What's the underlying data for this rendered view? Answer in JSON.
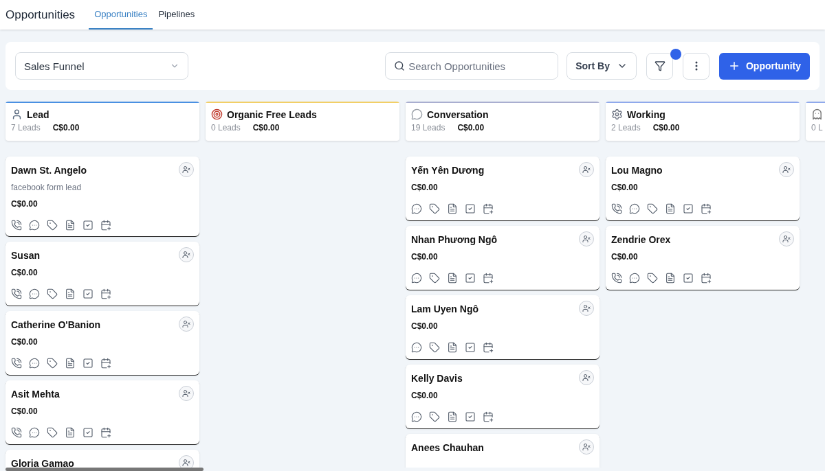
{
  "header": {
    "title": "Opportunities",
    "tabs": [
      {
        "label": "Opportunities",
        "selected": true
      },
      {
        "label": "Pipelines",
        "selected": false
      }
    ]
  },
  "toolbar": {
    "pipeline": "Sales Funnel",
    "search": {
      "placeholder": "Search Opportunities"
    },
    "sort": "Sort By",
    "filter_active": true,
    "add_button": "Opportunity"
  },
  "columns": [
    {
      "kind": "person",
      "title": "Lead",
      "count": "7 Leads",
      "total": "C$0.00",
      "color": "#4a90e2",
      "cards": [
        {
          "name": "Dawn St. Angelo",
          "subtitle": "facebook form lead",
          "value": "C$0.00",
          "call": true
        },
        {
          "name": "Susan",
          "value": "C$0.00",
          "call": true
        },
        {
          "name": "Catherine O'Banion",
          "value": "C$0.00",
          "call": true
        },
        {
          "name": "Asit Mehta",
          "value": "C$0.00",
          "call": true
        },
        {
          "name": "Gloria Gamao"
        }
      ]
    },
    {
      "kind": "target",
      "title": "Organic Free Leads",
      "count": "0 Leads",
      "total": "C$0.00",
      "color": "#f2cf66"
    },
    {
      "kind": "chat",
      "title": "Conversation",
      "count": "19 Leads",
      "total": "C$0.00",
      "color": "#a9aed0",
      "cards": [
        {
          "name": "Yến Yên Dương",
          "value": "C$0.00",
          "call": false
        },
        {
          "name": "Nhan Phương Ngô",
          "value": "C$0.00",
          "call": false
        },
        {
          "name": "Lam Uyen Ngô",
          "value": "C$0.00",
          "call": false
        },
        {
          "name": "Kelly Davis",
          "value": "C$0.00",
          "call": false
        },
        {
          "name": "Anees Chauhan"
        }
      ]
    },
    {
      "kind": "gear",
      "title": "Working",
      "count": "2 Leads",
      "total": "C$0.00",
      "color": "#8fa9ec",
      "cards": [
        {
          "name": "Lou Magno",
          "value": "C$0.00",
          "call": true
        },
        {
          "name": "Zendrie Orex",
          "value": "C$0.00",
          "call": true
        }
      ]
    },
    {
      "kind": "ghost",
      "count": "0 L",
      "color": "#8fa9ec"
    }
  ]
}
